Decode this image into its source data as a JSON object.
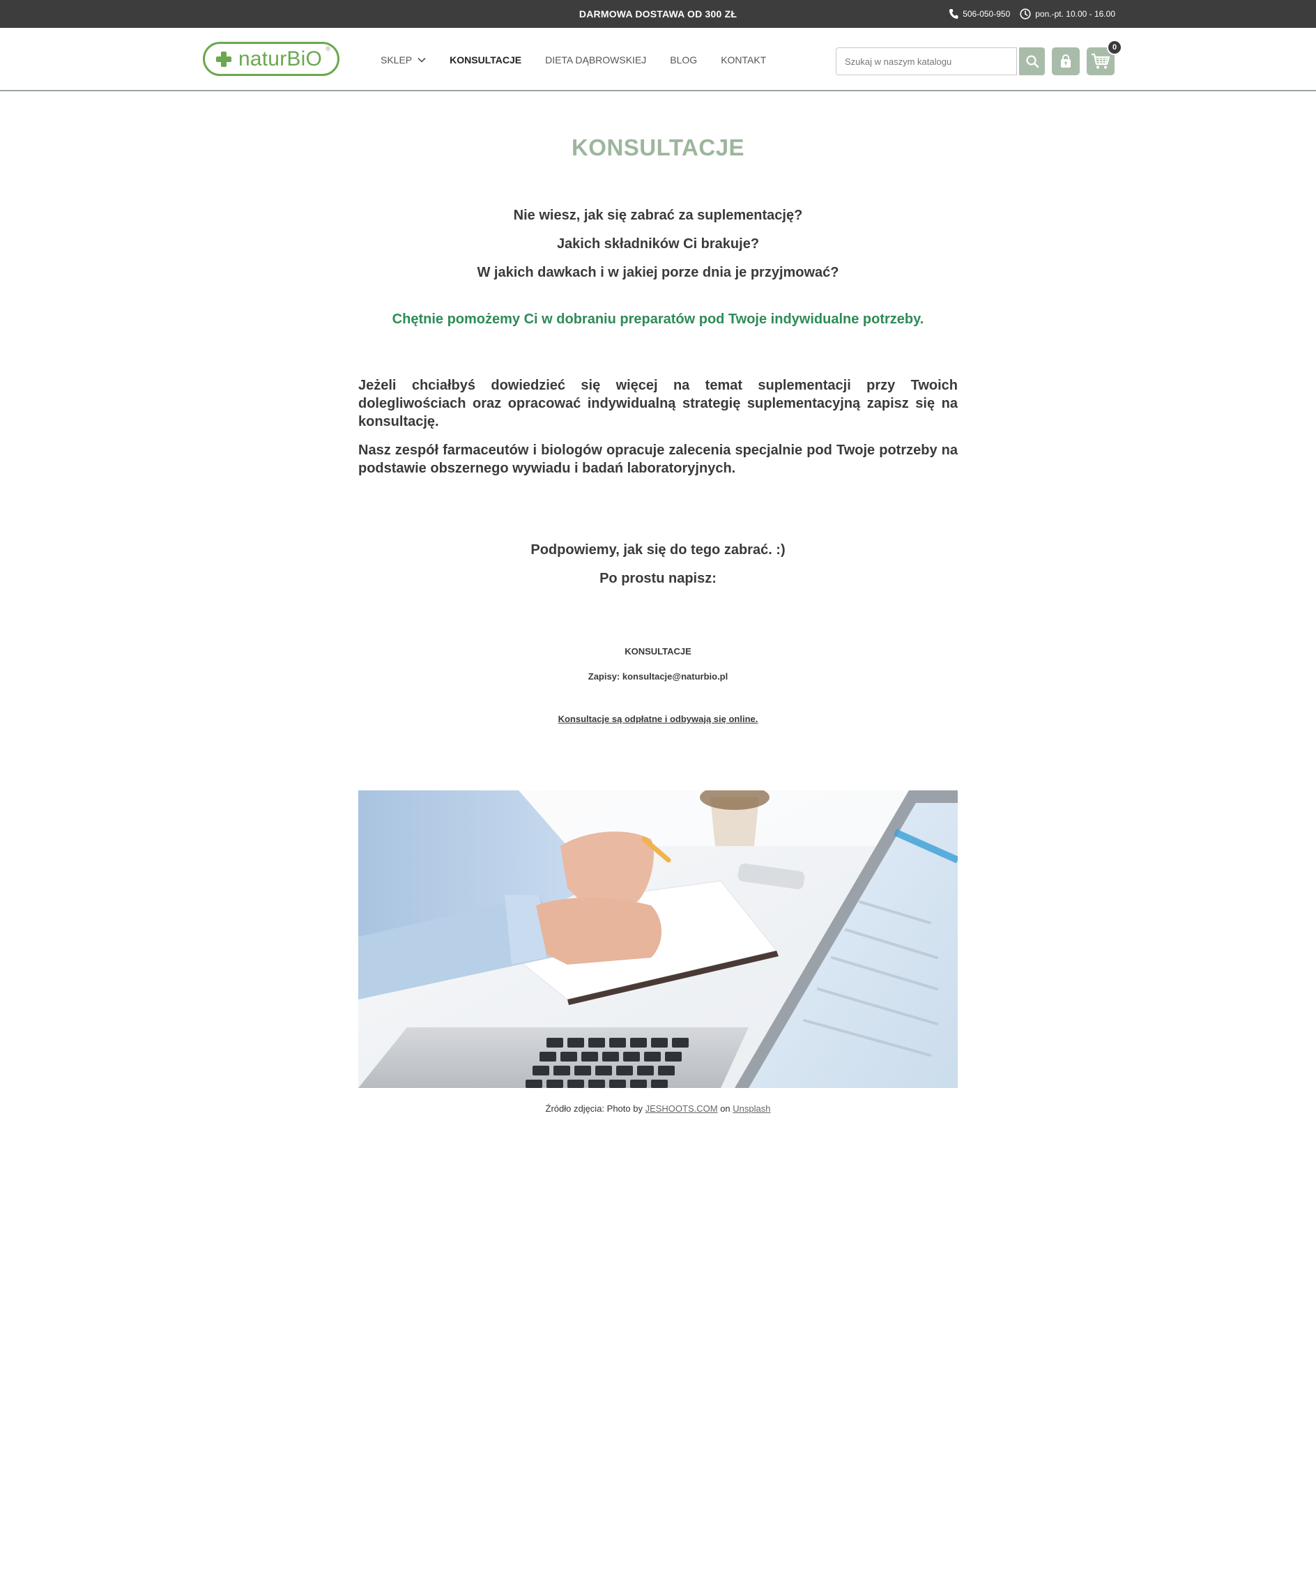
{
  "topbar": {
    "promo": "DARMOWA DOSTAWA OD 300 ZŁ",
    "phone": "506-050-950",
    "hours": "pon.-pt. 10.00 - 16.00"
  },
  "header": {
    "logo_text": "naturBiO",
    "nav": [
      {
        "label": "SKLEP"
      },
      {
        "label": "KONSULTACJE"
      },
      {
        "label": "DIETA DĄBROWSKIEJ"
      },
      {
        "label": "BLOG"
      },
      {
        "label": "KONTAKT"
      }
    ],
    "search_placeholder": "Szukaj w naszym katalogu",
    "cart_count": "0"
  },
  "page": {
    "title": "KONSULTACJE",
    "questions": [
      "Nie wiesz, jak się zabrać za suplementację?",
      "Jakich składników Ci brakuje?",
      "W jakich dawkach i w jakiej porze dnia je przyjmować?"
    ],
    "highlight": "Chętnie pomożemy Ci w dobraniu preparatów pod Twoje indywidualne potrzeby.",
    "paragraphs": [
      "Jeżeli chciałbyś dowiedzieć się więcej na temat suplementacji przy Twoich dolegliwościach oraz opracować indywidualną strategię suplementacyjną zapisz się na konsultację.",
      "Nasz zespół farmaceutów i biologów opracuje zalecenia specjalnie pod Twoje potrzeby na podstawie obszernego wywiadu i badań laboratoryjnych."
    ],
    "cta_lines": [
      "Podpowiemy, jak się do tego zabrać. :)",
      "Po prostu napisz:"
    ],
    "contact_heading": "KONSULTACJE",
    "contact_line": "Zapisy: konsultacje@naturbio.pl",
    "note": "Konsultacje są odpłatne i odbywają się online.",
    "caption": {
      "prefix": "Źródło zdjęcia: Photo by ",
      "author": "JESHOOTS.COM",
      "middle": " on ",
      "site": "Unsplash"
    }
  },
  "colors": {
    "topbar_bg": "#3d3d3d",
    "brand_green": "#6aa84f",
    "title_sage": "#9db59d",
    "highlight_green": "#2e8b57",
    "button_sage": "#a9bca9"
  }
}
